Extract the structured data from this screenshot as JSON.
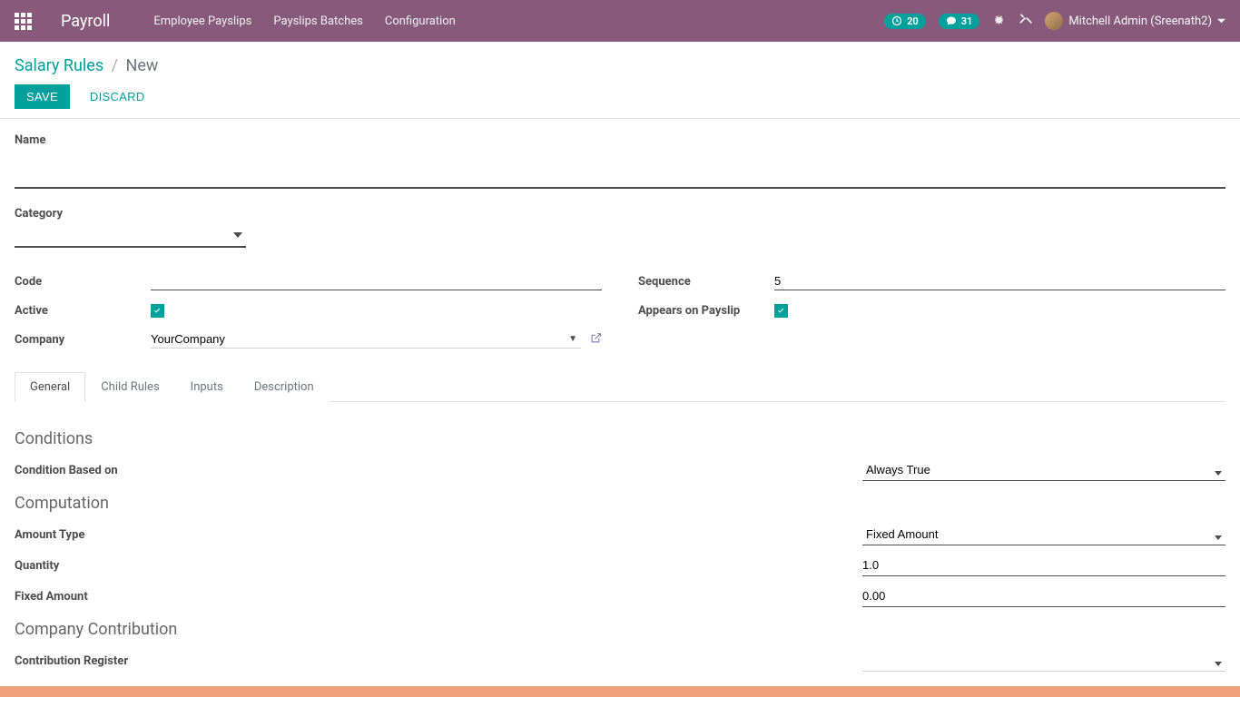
{
  "navbar": {
    "brand": "Payroll",
    "menu": [
      {
        "label": "Employee Payslips"
      },
      {
        "label": "Payslips Batches"
      },
      {
        "label": "Configuration"
      }
    ],
    "activity_count": "20",
    "message_count": "31",
    "user_name": "Mitchell Admin (Sreenath2)"
  },
  "breadcrumb": {
    "parent": "Salary Rules",
    "current": "New"
  },
  "buttons": {
    "save": "Save",
    "discard": "Discard"
  },
  "labels": {
    "name": "Name",
    "category": "Category",
    "code": "Code",
    "active": "Active",
    "company": "Company",
    "sequence": "Sequence",
    "appears_on_payslip": "Appears on Payslip"
  },
  "values": {
    "name": "",
    "category": "",
    "code": "",
    "active": true,
    "company": "YourCompany",
    "sequence": "5",
    "appears_on_payslip": true
  },
  "tabs": {
    "general": "General",
    "child_rules": "Child Rules",
    "inputs": "Inputs",
    "description": "Description"
  },
  "general": {
    "sections": {
      "conditions": "Conditions",
      "computation": "Computation",
      "company_contribution": "Company Contribution"
    },
    "labels": {
      "condition_based_on": "Condition Based on",
      "amount_type": "Amount Type",
      "quantity": "Quantity",
      "fixed_amount": "Fixed Amount",
      "contribution_register": "Contribution Register"
    },
    "values": {
      "condition_based_on": "Always True",
      "amount_type": "Fixed Amount",
      "quantity": "1.0",
      "fixed_amount": "0.00",
      "contribution_register": ""
    }
  }
}
